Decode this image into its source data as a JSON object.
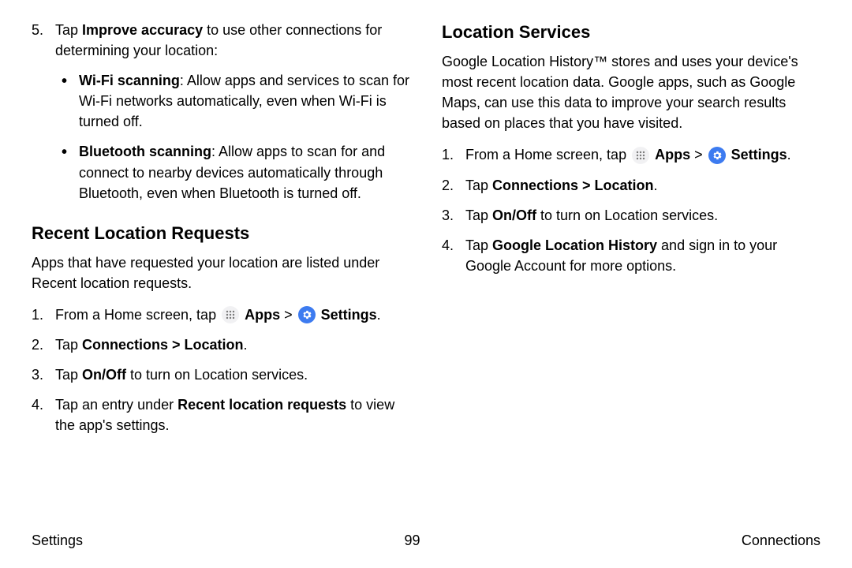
{
  "left": {
    "step5": {
      "num": "5.",
      "pre": "Tap ",
      "bold": "Improve accuracy",
      "post": " to use other connections for determining your location:"
    },
    "bullets": [
      {
        "bold": "Wi-Fi scanning",
        "text": ": Allow apps and services to scan for Wi-Fi networks automatically, even when Wi-Fi is turned off."
      },
      {
        "bold": "Bluetooth scanning",
        "text": ": Allow apps to scan for and connect to nearby devices automatically through Bluetooth, even when Bluetooth is turned off."
      }
    ],
    "heading": "Recent Location Requests",
    "intro": "Apps that have requested your location are listed under Recent location requests.",
    "steps": {
      "s1": {
        "num": "1.",
        "pre": "From a Home screen, tap ",
        "apps": "Apps",
        "gt": " > ",
        "settings": "Settings",
        "post": "."
      },
      "s2": {
        "num": "2.",
        "pre": "Tap ",
        "bold": "Connections > Location",
        "post": "."
      },
      "s3": {
        "num": "3.",
        "pre": "Tap ",
        "bold": "On/Off",
        "post": " to turn on Location services."
      },
      "s4": {
        "num": "4.",
        "pre": "Tap an entry under ",
        "bold": "Recent location requests",
        "post": " to view the app's settings."
      }
    }
  },
  "right": {
    "heading": "Location Services",
    "intro": "Google Location History™ stores and uses your device's most recent location data. Google apps, such as Google Maps, can use this data to improve your search results based on places that you have visited.",
    "steps": {
      "s1": {
        "num": "1.",
        "pre": "From a Home screen, tap ",
        "apps": "Apps",
        "gt": " > ",
        "settings": "Settings",
        "post": "."
      },
      "s2": {
        "num": "2.",
        "pre": "Tap ",
        "bold": "Connections > Location",
        "post": "."
      },
      "s3": {
        "num": "3.",
        "pre": "Tap ",
        "bold": "On/Off",
        "post": " to turn on Location services."
      },
      "s4": {
        "num": "4.",
        "pre": "Tap ",
        "bold": "Google Location History",
        "post": " and sign in to your Google Account for more options."
      }
    }
  },
  "footer": {
    "left": "Settings",
    "center": "99",
    "right": "Connections"
  }
}
